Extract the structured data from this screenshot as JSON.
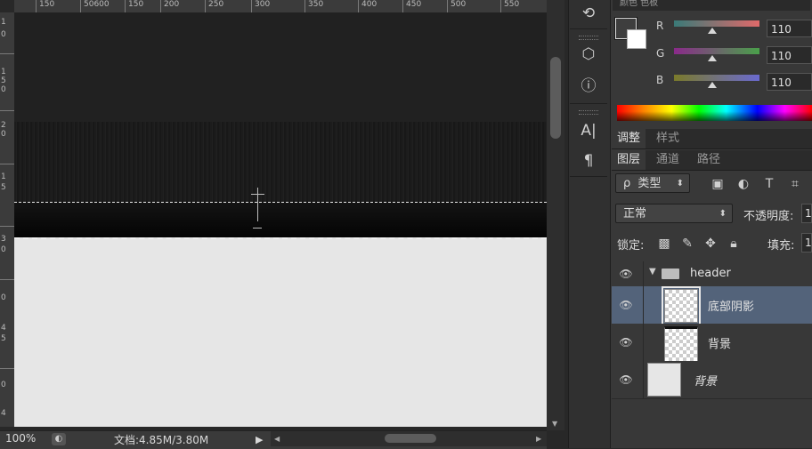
{
  "ruler": {
    "top_labels": [
      "150",
      "50600",
      "150",
      "200",
      "250",
      "300",
      "350",
      "400",
      "450",
      "500",
      "550"
    ],
    "left_labels": [
      "1",
      "0",
      "1",
      "5",
      "0",
      "2",
      "0",
      "1",
      "5",
      "3",
      "0",
      "0",
      "4",
      "5",
      "0",
      "4"
    ]
  },
  "status": {
    "zoom": "100%",
    "doc_info": "文档:4.85M/3.80M",
    "play_icon": "play-icon"
  },
  "tools": [
    "history-icon",
    "3d-cube-icon",
    "info-icon",
    "character-icon",
    "paragraph-icon"
  ],
  "color_panel": {
    "header_text": "颜色  色板",
    "channels": [
      {
        "label": "R",
        "value": "110",
        "gradient": [
          "#3a7a78",
          "#e06a6a"
        ]
      },
      {
        "label": "G",
        "value": "110",
        "gradient": [
          "#8a2a8a",
          "#4aa04a"
        ]
      },
      {
        "label": "B",
        "value": "110",
        "gradient": [
          "#7a7a2a",
          "#6a6ad0"
        ]
      }
    ],
    "spectrum": "rainbow"
  },
  "adjust_tabs": [
    "调整",
    "样式"
  ],
  "layers_tabs": [
    "图层",
    "通道",
    "路径"
  ],
  "layers_panel": {
    "filter_label": "类型",
    "filter_prefix": "ρ",
    "blend_mode": "正常",
    "opacity_label": "不透明度:",
    "opacity_value": "1",
    "lock_label": "锁定:",
    "fill_label": "填充:",
    "fill_value": "1",
    "layers": [
      {
        "name": "header",
        "type": "group",
        "expanded": true
      },
      {
        "name": "底部阴影",
        "type": "layer",
        "selected": true
      },
      {
        "name": "背景",
        "type": "layer"
      },
      {
        "name": "背景",
        "type": "background",
        "italic": true
      }
    ]
  },
  "colors": {
    "canvas_light": "#e6e6e6",
    "canvas_dark": "#212121",
    "panel_bg": "#383838",
    "selected_layer": "#53637a"
  }
}
